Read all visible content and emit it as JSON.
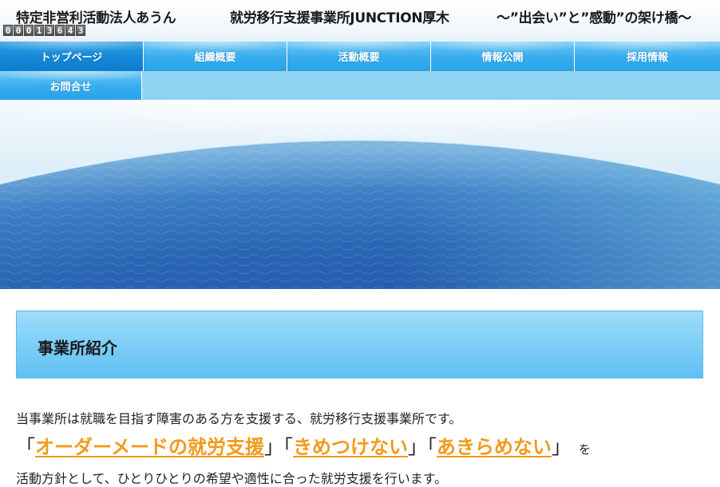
{
  "header": {
    "org_name": "特定非営利活動法人あうん",
    "office_name": "就労移行支援事業所JUNCTION厚木",
    "tagline": "〜”出会い”と”感動”の架け橋〜",
    "counter_digits": [
      "0",
      "0",
      "0",
      "1",
      "3",
      "6",
      "4",
      "3"
    ]
  },
  "nav": {
    "row1": [
      {
        "label": "トップページ",
        "active": true
      },
      {
        "label": "組織概要"
      },
      {
        "label": "活動概要"
      },
      {
        "label": "情報公開"
      },
      {
        "label": "採用情報"
      }
    ],
    "row2": [
      {
        "label": "お問合せ"
      }
    ]
  },
  "section": {
    "heading": "事業所紹介"
  },
  "content": {
    "intro": "当事業所は就職を目指す障害のある方を支援する、就労移行支援事業所です。",
    "open_bracket": "「",
    "close_bracket": "」",
    "keyword1": "オーダーメードの就労支援",
    "keyword2": "きめつけない",
    "keyword3": "あきらめない",
    "particle": "を",
    "closing": "活動方針として、ひとりひとりの希望や適性に合った就労支援を行います。"
  },
  "colors": {
    "nav_blue": "#2aa3e8",
    "nav_active": "#0d7ccc",
    "keyword_orange": "#f29a1c",
    "section_box": "#5fc0f3"
  }
}
